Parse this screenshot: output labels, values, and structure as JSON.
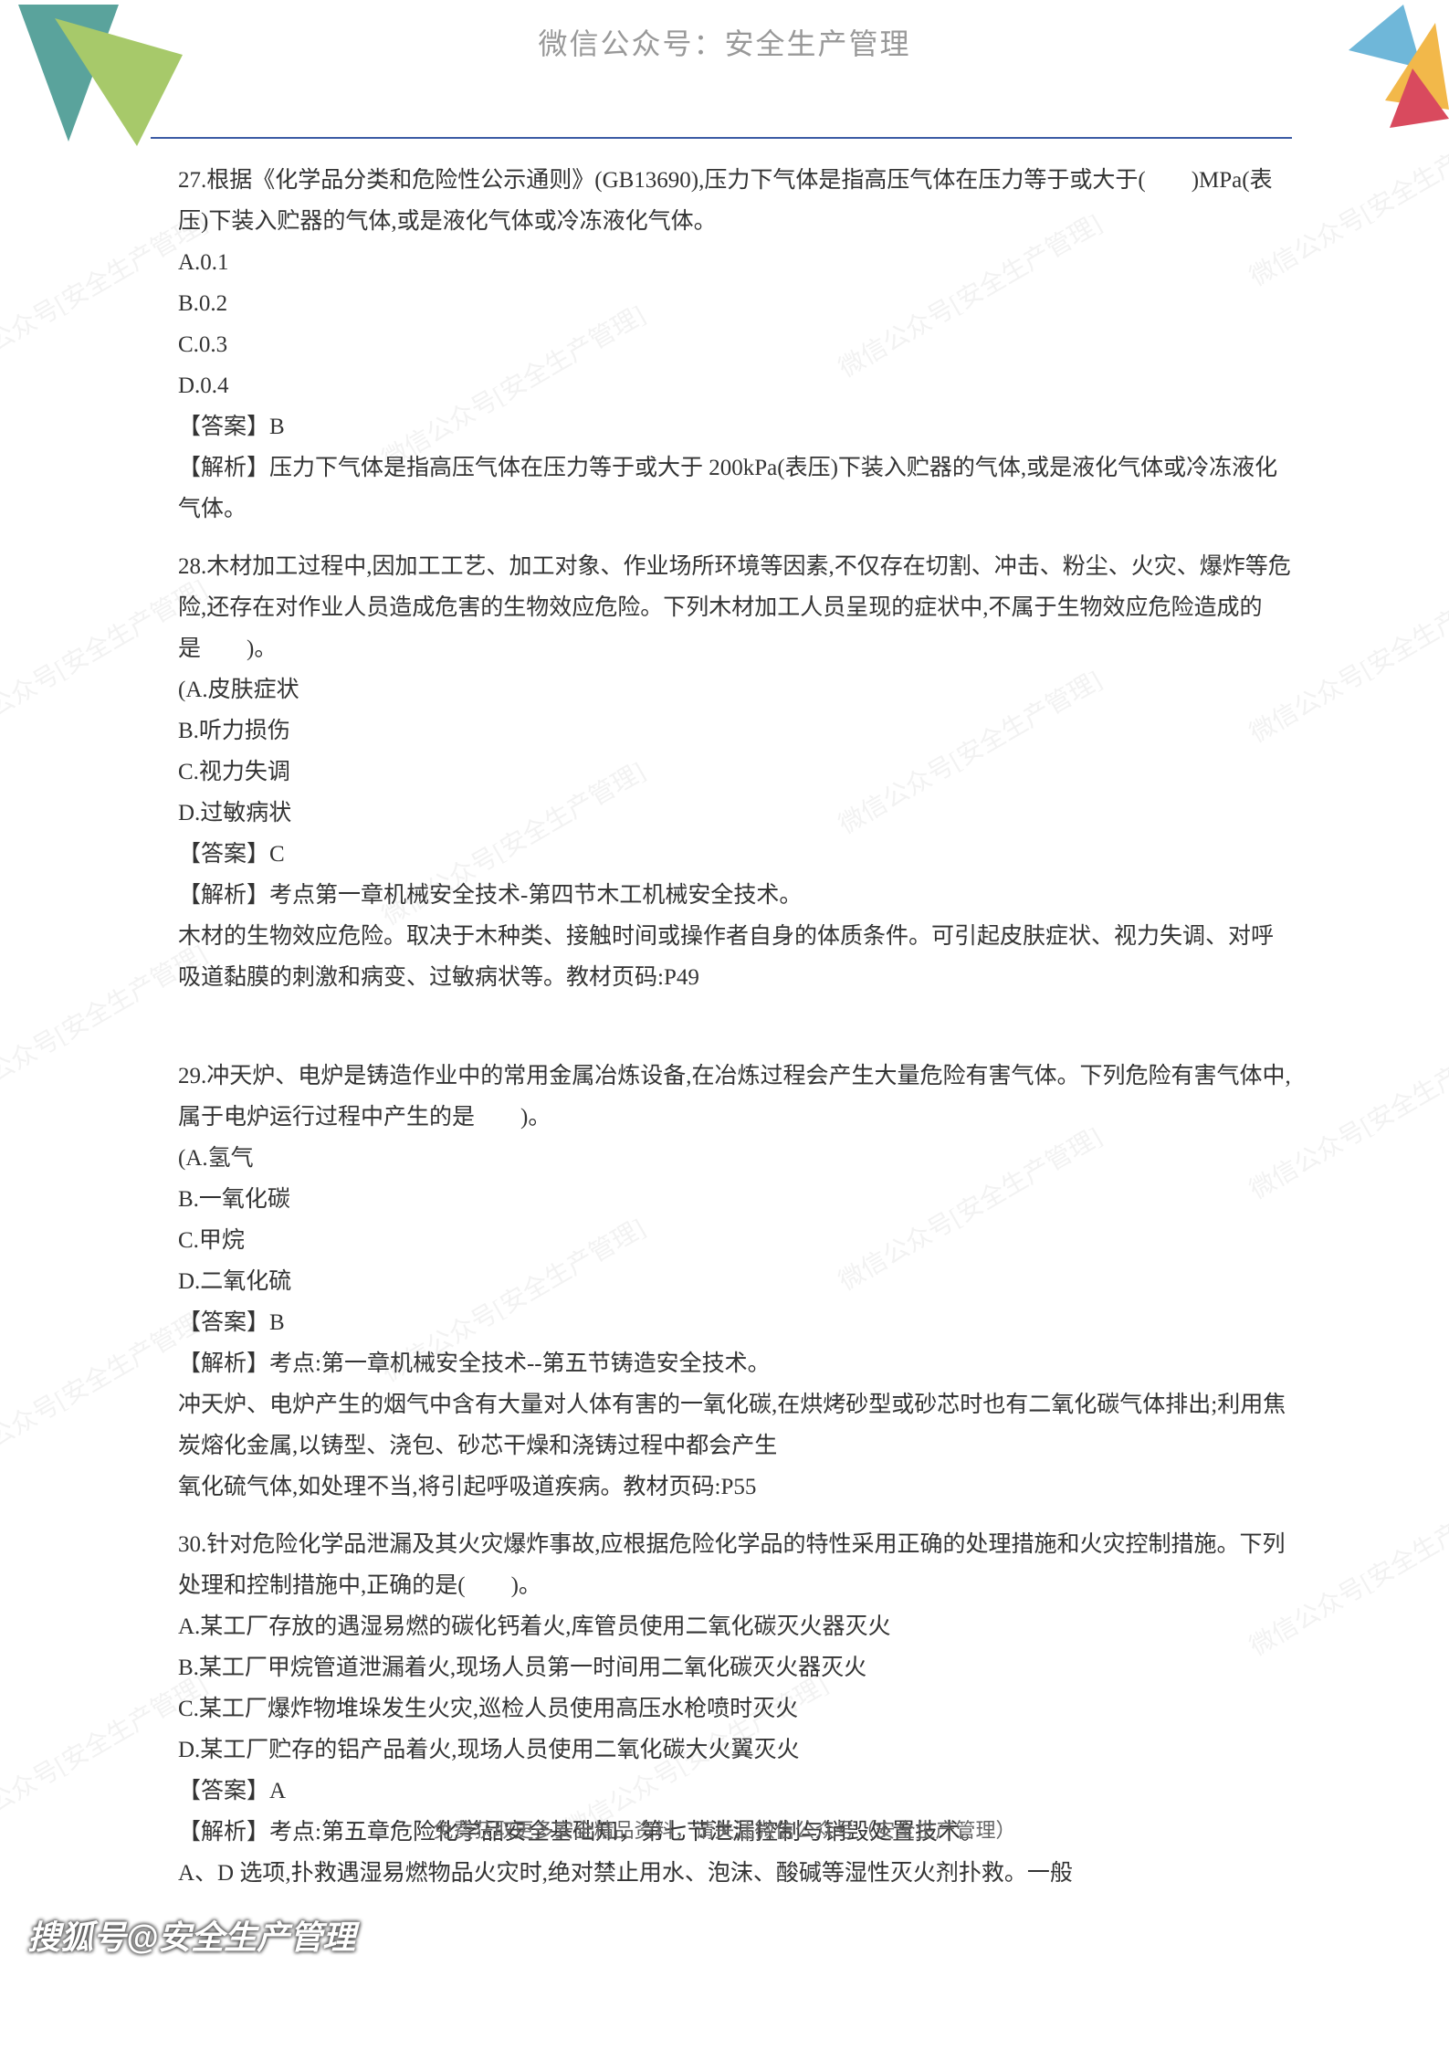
{
  "header_watermark": "微信公众号：安全生产管理",
  "diag_watermark_text": "微信公众号[安全生产管理]",
  "questions": [
    {
      "num": "27",
      "stem": "27.根据《化学品分类和危险性公示通则》(GB13690),压力下气体是指高压气体在压力等于或大于(　　)MPa(表压)下装入贮器的气体,或是液化气体或冷冻液化气体。",
      "options": [
        "A.0.1",
        "B.0.2",
        "C.0.3",
        "D.0.4"
      ],
      "answer_label": "【答案】",
      "answer": "B",
      "analysis_label": "【解析】",
      "analysis": "压力下气体是指高压气体在压力等于或大于 200kPa(表压)下装入贮器的气体,或是液化气体或冷冻液化气体。"
    },
    {
      "num": "28",
      "stem": "28.木材加工过程中,因加工工艺、加工对象、作业场所环境等因素,不仅存在切割、冲击、粉尘、火灾、爆炸等危险,还存在对作业人员造成危害的生物效应危险。下列木材加工人员呈现的症状中,不属于生物效应危险造成的是　　)。",
      "options": [
        "(A.皮肤症状",
        "B.听力损伤",
        "C.视力失调",
        "D.过敏病状"
      ],
      "answer_label": "【答案】",
      "answer": "C",
      "analysis_label": "【解析】",
      "analysis": "考点第一章机械安全技术-第四节木工机械安全技术。\n木材的生物效应危险。取决于木种类、接触时间或操作者自身的体质条件。可引起皮肤症状、视力失调、对呼吸道黏膜的刺激和病变、过敏病状等。教材页码:P49"
    },
    {
      "num": "29",
      "stem": "29.冲天炉、电炉是铸造作业中的常用金属冶炼设备,在冶炼过程会产生大量危险有害气体。下列危险有害气体中,属于电炉运行过程中产生的是　　)。",
      "options": [
        "(A.氢气",
        "B.一氧化碳",
        "C.甲烷",
        "D.二氧化硫"
      ],
      "answer_label": "【答案】",
      "answer": "B",
      "analysis_label": "【解析】",
      "analysis": "考点:第一章机械安全技术--第五节铸造安全技术。\n冲天炉、电炉产生的烟气中含有大量对人体有害的一氧化碳,在烘烤砂型或砂芯时也有二氧化碳气体排出;利用焦炭熔化金属,以铸型、浇包、砂芯干燥和浇铸过程中都会产生\n氧化硫气体,如处理不当,将引起呼吸道疾病。教材页码:P55"
    },
    {
      "num": "30",
      "stem": "30.针对危险化学品泄漏及其火灾爆炸事故,应根据危险化学品的特性采用正确的处理措施和火灾控制措施。下列处理和控制措施中,正确的是(　　)。",
      "options": [
        "A.某工厂存放的遇湿易燃的碳化钙着火,库管员使用二氧化碳灭火器灭火",
        "B.某工厂甲烷管道泄漏着火,现场人员第一时间用二氧化碳灭火器灭火",
        "C.某工厂爆炸物堆垛发生火灾,巡检人员使用高压水枪喷时灭火",
        "D.某工厂贮存的铝产品着火,现场人员使用二氧化碳大火翼灭火"
      ],
      "answer_label": "【答案】",
      "answer": "A",
      "analysis_label": "【解析】",
      "analysis": "考点:第五章危险化学品安全基础知，第七节泄漏控制与销毁处置技术。\nA、D 选项,扑救遇湿易燃物品火灾时,绝对禁止用水、泡沫、酸碱等湿性灭火剂扑救。一般"
    }
  ],
  "footer_text": "免费获取更多安全精品资料，请关注微信公众号（安全生产管理）",
  "sohu_tag": "搜狐号@安全生产管理"
}
